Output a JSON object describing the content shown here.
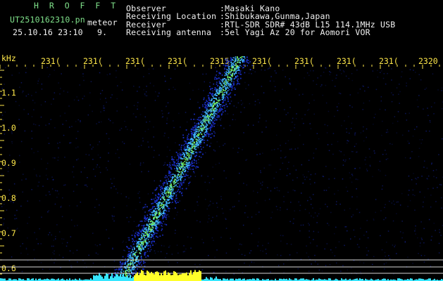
{
  "logo": "H R O F F T",
  "file": {
    "name": "UT2510162310.pn",
    "kind": "meteor",
    "date_time": "25.10.16 23:10",
    "value": "9."
  },
  "meta": {
    "observer_label": "Observer",
    "observer_value": ":Masaki Kano",
    "location_label": "Receiving Location",
    "location_value": ":Shibukawa,Gunma,Japan",
    "receiver_label": "Receiver",
    "receiver_value": ":RTL-SDR SDR# 43dB L15 114.1MHz USB",
    "antenna_label": "Receiving antenna",
    "antenna_value": ":5el Yagi Az 20 for Aomori VOR"
  },
  "axes": {
    "y_unit": "kHz",
    "x_ticks": [
      "231(",
      "231(",
      "231(",
      "231(",
      "2315",
      "231(",
      "231(",
      "231(",
      "231(",
      "2320"
    ],
    "y_ticks": [
      "1.1",
      "1.0",
      "0.9",
      "0.8",
      "0.7",
      "0.6"
    ]
  },
  "colors": {
    "background": "#000000",
    "axis_text": "#ffe84a",
    "logo": "#7fe08a",
    "signal_low": "#1a2fc8",
    "signal_mid": "#3fb0ff",
    "signal_high": "#7dff6a",
    "baseline_cyan": "#35e6ff",
    "baseline_yellow": "#ffff2a"
  }
}
